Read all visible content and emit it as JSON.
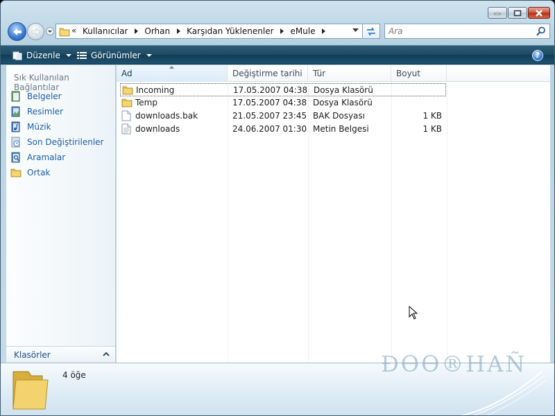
{
  "window": {
    "controls": {
      "minimize": "minimize",
      "maximize": "maximize",
      "close": "close"
    }
  },
  "address": {
    "overflow": "«",
    "crumbs": [
      "Kullanıcılar",
      "Orhan",
      "Karşıdan Yüklenenler",
      "eMule"
    ]
  },
  "search": {
    "placeholder": "Ara"
  },
  "toolbar": {
    "organize_label": "Düzenle",
    "views_label": "Görünümler",
    "help_label": "?"
  },
  "navpane": {
    "favorites_title": "Sık Kullanılan Bağlantılar",
    "favorites": [
      {
        "label": "Belgeler",
        "icon": "documents-icon"
      },
      {
        "label": "Resimler",
        "icon": "pictures-icon"
      },
      {
        "label": "Müzik",
        "icon": "music-icon"
      },
      {
        "label": "Son Değiştirilenler",
        "icon": "recent-icon"
      },
      {
        "label": "Aramalar",
        "icon": "searches-icon"
      },
      {
        "label": "Ortak",
        "icon": "public-folder-icon"
      }
    ],
    "folders_label": "Klasörler"
  },
  "columns": {
    "name": "Ad",
    "date": "Değiştirme tarihi",
    "type": "Tür",
    "size": "Boyut"
  },
  "files": [
    {
      "name": "Incoming",
      "date": "17.05.2007 04:38",
      "type": "Dosya Klasörü",
      "size": "",
      "icon": "folder-icon"
    },
    {
      "name": "Temp",
      "date": "17.05.2007 04:38",
      "type": "Dosya Klasörü",
      "size": "",
      "icon": "folder-icon"
    },
    {
      "name": "downloads.bak",
      "date": "21.05.2007 23:45",
      "type": "BAK Dosyası",
      "size": "1 KB",
      "icon": "file-icon"
    },
    {
      "name": "downloads",
      "date": "24.06.2007 01:30",
      "type": "Metin Belgesi",
      "size": "1 KB",
      "icon": "text-file-icon"
    }
  ],
  "details": {
    "item_count": "4 öğe"
  },
  "watermark": "ĐƟƟ®HAÑ",
  "colors": {
    "accent": "#1c5ea8",
    "command_bar": "#1c4a64",
    "folder": "#e7c55a"
  }
}
